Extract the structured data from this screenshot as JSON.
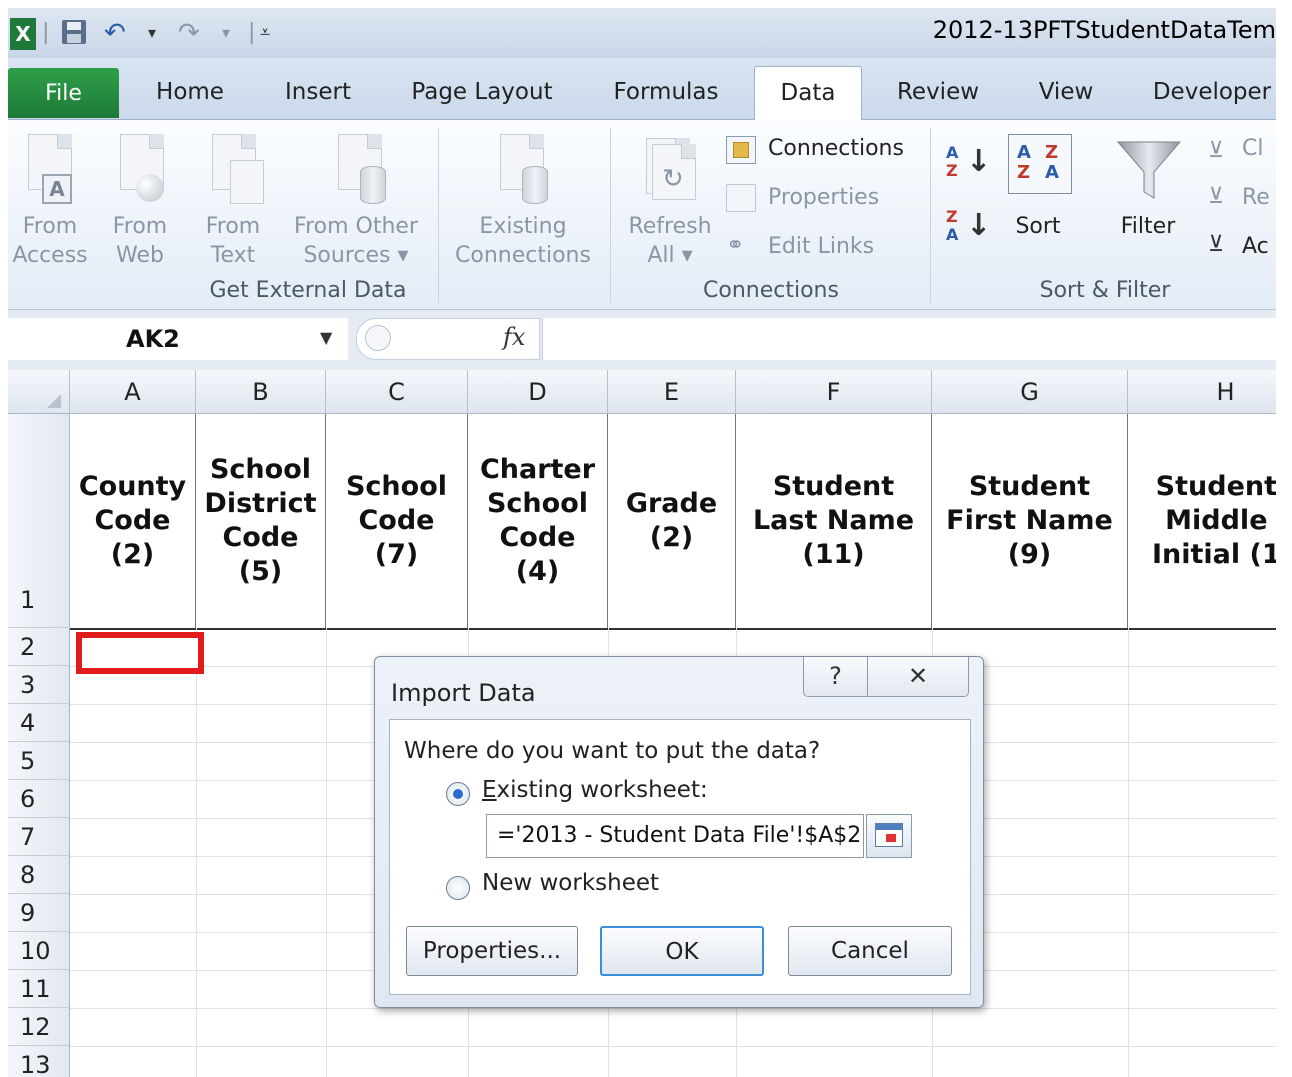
{
  "window": {
    "title": "2012-13PFTStudentDataTem"
  },
  "tabs": [
    "File",
    "Home",
    "Insert",
    "Page Layout",
    "Formulas",
    "Data",
    "Review",
    "View",
    "Developer"
  ],
  "ribbon": {
    "get_external": {
      "buttons": [
        {
          "l1": "From",
          "l2": "Access"
        },
        {
          "l1": "From",
          "l2": "Web"
        },
        {
          "l1": "From",
          "l2": "Text"
        },
        {
          "l1": "From Other",
          "l2": "Sources ▾"
        },
        {
          "l1": "Existing",
          "l2": "Connections"
        }
      ],
      "group_label": "Get External Data"
    },
    "connections": {
      "refresh_l1": "Refresh",
      "refresh_l2": "All ▾",
      "connections": "Connections",
      "properties": "Properties",
      "edit_links": "Edit Links",
      "group_label": "Connections"
    },
    "sort_filter": {
      "sort": "Sort",
      "filter": "Filter",
      "clear": "Cl",
      "reapply": "Re",
      "advanced": "Ac",
      "group_label": "Sort & Filter"
    }
  },
  "formula_bar": {
    "name_box": "AK2",
    "fx": "fx"
  },
  "columns": [
    "A",
    "B",
    "C",
    "D",
    "E",
    "F",
    "G",
    "H"
  ],
  "headers": [
    [
      "County",
      "Code",
      "(2)"
    ],
    [
      "School",
      "District",
      "Code",
      "(5)"
    ],
    [
      "School",
      "Code",
      "(7)"
    ],
    [
      "Charter",
      "School",
      "Code",
      "(4)"
    ],
    [
      "Grade",
      "(2)"
    ],
    [
      "Student",
      "Last Name",
      "(11)"
    ],
    [
      "Student",
      "First Name",
      "(9)"
    ],
    [
      "Student",
      "Middle",
      "Initial (1"
    ]
  ],
  "rows": [
    "1",
    "2",
    "3",
    "4",
    "5",
    "6",
    "7",
    "8",
    "9",
    "10",
    "11",
    "12",
    "13"
  ],
  "dialog": {
    "title": "Import Data",
    "help": "?",
    "close": "✕",
    "question": "Where do you want to put the data?",
    "existing_label": "Existing worksheet:",
    "existing_value": "='2013 - Student Data File'!$A$2",
    "new_label": "New worksheet",
    "properties_btn": "Properties...",
    "ok_btn": "OK",
    "cancel_btn": "Cancel"
  }
}
